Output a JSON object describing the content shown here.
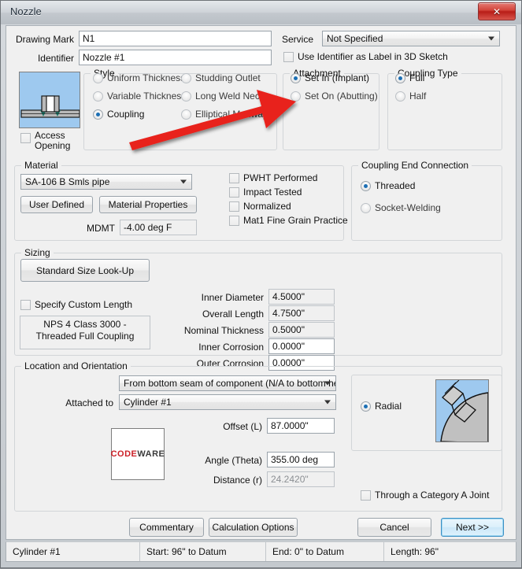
{
  "window": {
    "title": "Nozzle",
    "close_icon": "close-icon"
  },
  "top": {
    "drawing_mark_label": "Drawing Mark",
    "drawing_mark_value": "N1",
    "identifier_label": "Identifier",
    "identifier_value": "Nozzle #1",
    "service_label": "Service",
    "service_value": "Not Specified",
    "use_identifier_label": "Use Identifier as Label in 3D Sketch"
  },
  "nozzle_preview": {
    "access_opening_label_line1": "Access",
    "access_opening_label_line2": "Opening"
  },
  "style": {
    "title": "Style",
    "options": [
      {
        "label": "Uniform Thickness",
        "selected": false
      },
      {
        "label": "Variable Thickness",
        "selected": false
      },
      {
        "label": "Coupling",
        "selected": true
      },
      {
        "label": "Studding Outlet",
        "selected": false
      },
      {
        "label": "Long Weld Neck",
        "selected": false
      },
      {
        "label": "Elliptical Manway",
        "selected": false
      }
    ]
  },
  "attachment": {
    "title": "Attachment",
    "options": [
      {
        "label": "Set In (Implant)",
        "selected": true
      },
      {
        "label": "Set On (Abutting)",
        "selected": false
      }
    ]
  },
  "coupling_type": {
    "title": "Coupling Type",
    "options": [
      {
        "label": "Full",
        "selected": true
      },
      {
        "label": "Half",
        "selected": false
      }
    ]
  },
  "material": {
    "title": "Material",
    "value": "SA-106 B Smls pipe",
    "user_defined_label": "User Defined",
    "material_properties_label": "Material Properties",
    "mdmt_label": "MDMT",
    "mdmt_value": "-4.00 deg F",
    "checkboxes": [
      {
        "label": "PWHT Performed",
        "checked": false
      },
      {
        "label": "Impact Tested",
        "checked": false
      },
      {
        "label": "Normalized",
        "checked": false
      },
      {
        "label": "Mat1 Fine Grain Practice",
        "checked": false
      }
    ]
  },
  "coupling_end_connection": {
    "title": "Coupling End Connection",
    "options": [
      {
        "label": "Threaded",
        "selected": true
      },
      {
        "label": "Socket-Welding",
        "selected": false
      }
    ]
  },
  "sizing": {
    "title": "Sizing",
    "lookup_button_label": "Standard Size Look-Up",
    "specify_custom_length_label": "Specify Custom Length",
    "size_description": "NPS 4 Class 3000 - Threaded Full Coupling",
    "fields": [
      {
        "label": "Inner Diameter",
        "value": "4.5000\"",
        "readonly": true
      },
      {
        "label": "Overall Length",
        "value": "4.7500\"",
        "readonly": true
      },
      {
        "label": "Nominal Thickness",
        "value": "0.5000\"",
        "readonly": true
      },
      {
        "label": "Inner Corrosion",
        "value": "0.0000\"",
        "readonly": false
      },
      {
        "label": "Outer Corrosion",
        "value": "0.0000\"",
        "readonly": false
      }
    ]
  },
  "location": {
    "title": "Location and Orientation",
    "datum_value": "From bottom seam of component (N/A to bottom he",
    "attached_to_label": "Attached to",
    "attached_to_value": "Cylinder #1",
    "offset_label": "Offset (L)",
    "offset_value": "87.0000\"",
    "angle_label": "Angle (Theta)",
    "angle_value": "355.00 deg",
    "distance_label": "Distance (r)",
    "distance_value": "24.2420\"",
    "logo_part1": "CODE",
    "logo_part2": "WARE",
    "radial_label": "Radial",
    "radial_selected": true,
    "through_joint_label": "Through a Category A Joint"
  },
  "buttons": {
    "commentary": "Commentary",
    "calculation_options": "Calculation Options",
    "cancel": "Cancel",
    "next": "Next >>"
  },
  "statusbar": {
    "cells": [
      "Cylinder #1",
      "Start: 96\" to Datum",
      "End: 0\" to Datum",
      "Length: 96\""
    ]
  },
  "annotation": {
    "arrow_color": "#e8201a"
  }
}
